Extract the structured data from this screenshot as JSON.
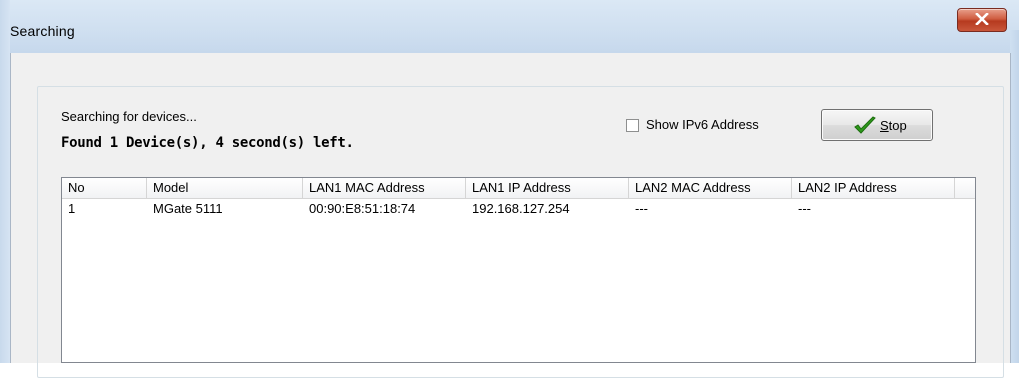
{
  "window": {
    "title": "Searching",
    "close_icon": "close-x-icon",
    "accent_close": "#c9563a"
  },
  "status": {
    "searching_text": "Searching for devices...",
    "found_text": "Found 1 Device(s), 4 second(s) left."
  },
  "options": {
    "show_ipv6_label": "Show IPv6 Address",
    "show_ipv6_checked": false
  },
  "stop_button": {
    "label_mnemonic": "S",
    "label_rest": "top",
    "icon": "green-checkmark-icon"
  },
  "table": {
    "columns": [
      "No",
      "Model",
      "LAN1 MAC Address",
      "LAN1 IP Address",
      "LAN2 MAC Address",
      "LAN2 IP Address",
      ""
    ],
    "rows": [
      [
        "1",
        "MGate 5111",
        "00:90:E8:51:18:74",
        "192.168.127.254",
        "---",
        "---"
      ]
    ]
  }
}
